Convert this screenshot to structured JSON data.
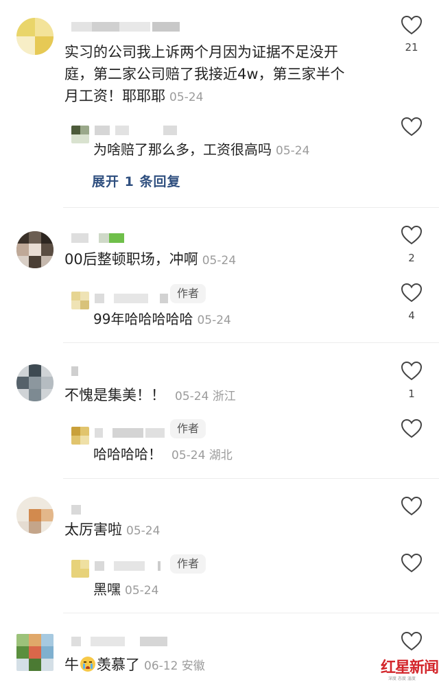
{
  "comments": [
    {
      "text_lines": [
        "实习的公司我上诉两个月因为证据不足没开",
        "庭，第二家公司赔了我接近4w，第三家半个",
        "月工资！耶耶耶"
      ],
      "date": "05-24",
      "likes": "21",
      "reply": {
        "text": "为啥赔了那么多，工资很高吗",
        "date": "05-24",
        "likes": ""
      },
      "expand_label": "展开 1 条回复"
    },
    {
      "text": "00后整顿职场，冲啊",
      "date": "05-24",
      "likes": "2",
      "reply": {
        "author_tag": "作者",
        "text": "99年哈哈哈哈哈",
        "date": "05-24",
        "likes": "4"
      }
    },
    {
      "text": "不愧是集美！！",
      "date": "05-24 浙江",
      "likes": "1",
      "reply": {
        "author_tag": "作者",
        "text": "哈哈哈哈！",
        "date": "05-24 湖北",
        "likes": ""
      }
    },
    {
      "text": "太厉害啦",
      "date": "05-24",
      "likes": "",
      "reply": {
        "author_tag": "作者",
        "text": "黑嘿",
        "date": "05-24",
        "likes": ""
      }
    },
    {
      "text_before_emoji": "牛",
      "text_after_emoji": "羡慕了",
      "date": "06-12 安徽",
      "likes": ""
    }
  ],
  "watermark": {
    "brand": "红星新闻",
    "sub": "深度 态度 温度"
  },
  "icons": {
    "like": "heart-outline-icon",
    "emoji": "crying-emoji-icon"
  },
  "colors": {
    "link": "#2f4f7f",
    "meta": "#9b9b9b",
    "brand": "#d3262b"
  }
}
